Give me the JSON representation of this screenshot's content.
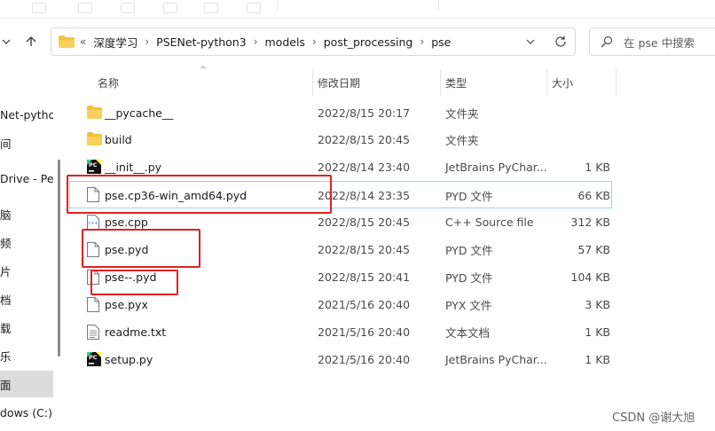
{
  "address_bar": {
    "overflow_glyph": "«",
    "crumbs": [
      "深度学习",
      "PSENet-python3",
      "models",
      "post_processing",
      "pse"
    ],
    "separator": "›"
  },
  "search": {
    "placeholder": "在 pse 中搜索"
  },
  "sidebar": {
    "items": [
      {
        "label": "Net-pytho"
      },
      {
        "label": "间"
      },
      {
        "label": "Drive - Pers"
      },
      {
        "label": "脑"
      },
      {
        "label": "频"
      },
      {
        "label": "片"
      },
      {
        "label": "档"
      },
      {
        "label": "载"
      },
      {
        "label": "乐"
      },
      {
        "label": "面",
        "selected": true
      },
      {
        "label": "dows (C:)"
      }
    ]
  },
  "columns": {
    "name": "名称",
    "date": "修改日期",
    "type": "类型",
    "size": "大小"
  },
  "files": [
    {
      "name": "__pycache__",
      "date": "2022/8/15 20:17",
      "type": "文件夹",
      "size": "",
      "icon": "folder-icon"
    },
    {
      "name": "build",
      "date": "2022/8/15 20:45",
      "type": "文件夹",
      "size": "",
      "icon": "folder-icon"
    },
    {
      "name": "__init__.py",
      "date": "2022/8/14 23:40",
      "type": "JetBrains PyChar...",
      "size": "1 KB",
      "icon": "pycharm-icon"
    },
    {
      "name": "pse.cp36-win_amd64.pyd",
      "date": "2022/8/14 23:35",
      "type": "PYD 文件",
      "size": "66 KB",
      "icon": "file-icon",
      "selected": true
    },
    {
      "name": "pse.cpp",
      "date": "2022/8/15 20:45",
      "type": "C++ Source file",
      "size": "312 KB",
      "icon": "cpp-file-icon"
    },
    {
      "name": "pse.pyd",
      "date": "2022/8/15 20:45",
      "type": "PYD 文件",
      "size": "57 KB",
      "icon": "file-icon"
    },
    {
      "name": "pse--.pyd",
      "date": "2022/8/15 20:41",
      "type": "PYD 文件",
      "size": "104 KB",
      "icon": "file-icon"
    },
    {
      "name": "pse.pyx",
      "date": "2021/5/16 20:40",
      "type": "PYX 文件",
      "size": "3 KB",
      "icon": "file-icon"
    },
    {
      "name": "readme.txt",
      "date": "2021/5/16 20:40",
      "type": "文本文档",
      "size": "1 KB",
      "icon": "text-file-icon"
    },
    {
      "name": "setup.py",
      "date": "2021/5/16 20:40",
      "type": "JetBrains PyChar...",
      "size": "1 KB",
      "icon": "pycharm-icon"
    }
  ],
  "colors": {
    "annotation_red": "#e02020",
    "selection_border": "#99d1ff",
    "folder_yellow": "#f3c23e"
  },
  "watermark": "CSDN @谢大旭"
}
